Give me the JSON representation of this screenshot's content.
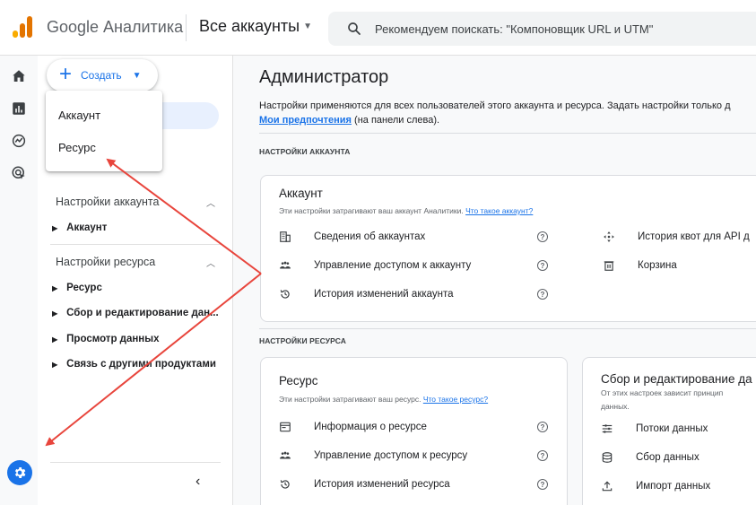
{
  "header": {
    "product": "Google Аналитика",
    "account": "Все аккаунты",
    "search_placeholder": "Рекомендуем поискать: \"Компоновщик URL и UTM\""
  },
  "sidebar": {
    "create_label": "Создать",
    "groups": [
      {
        "label": "Настройки аккаунта",
        "items": [
          "Аккаунт"
        ]
      },
      {
        "label": "Настройки ресурса",
        "items": [
          "Ресурс",
          "Сбор и редактирование дан...",
          "Просмотр данных",
          "Связь с другими продуктами"
        ]
      }
    ]
  },
  "dropdown": {
    "items": [
      "Аккаунт",
      "Ресурс"
    ]
  },
  "main": {
    "title": "Администратор",
    "desc_line1": "Настройки применяются для всех пользователей этого аккаунта и ресурса. Задать настройки только д",
    "desc_link": "Мои предпочтения",
    "desc_line2": " (на панели слева).",
    "account_section": "НАСТРОЙКИ АККАУНТА",
    "account_card": {
      "title": "Аккаунт",
      "sub": "Эти настройки затрагивают ваш аккаунт Аналитики. ",
      "sub_link": "Что такое аккаунт?",
      "left_rows": [
        "Сведения об аккаунтах",
        "Управление доступом к аккаунту",
        "История изменений аккаунта"
      ],
      "right_rows": [
        "История квот для API д",
        "Корзина"
      ]
    },
    "property_section": "НАСТРОЙКИ РЕСУРСА",
    "property_card": {
      "title": "Ресурс",
      "sub": "Эти настройки затрагивают ваш ресурс. ",
      "sub_link": "Что такое ресурс?",
      "rows": [
        "Информация о ресурсе",
        "Управление доступом к ресурсу",
        "История изменений ресурса"
      ]
    },
    "data_card": {
      "title": "Сбор и редактирование да",
      "sub1": "От этих настроек зависит принцип",
      "sub2": "данных.",
      "rows": [
        "Потоки данных",
        "Сбор данных",
        "Импорт данных"
      ]
    }
  },
  "colors": {
    "accent": "#1a73e8",
    "annotation": "#e8453c"
  }
}
